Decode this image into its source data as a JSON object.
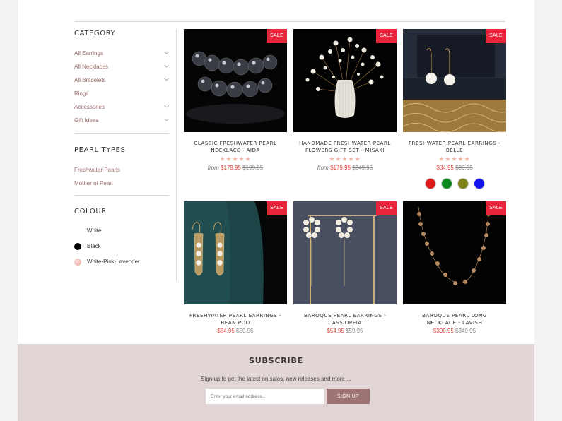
{
  "sidebar": {
    "category_heading": "CATEGORY",
    "categories": [
      {
        "label": "All Earrings",
        "expandable": true
      },
      {
        "label": "All Necklaces",
        "expandable": true
      },
      {
        "label": "All Bracelets",
        "expandable": true
      },
      {
        "label": "Rings",
        "expandable": false
      },
      {
        "label": "Accessories",
        "expandable": true
      },
      {
        "label": "Gift Ideas",
        "expandable": true
      }
    ],
    "pearl_types_heading": "PEARL TYPES",
    "pearl_types": [
      "Freshwater Pearls",
      "Mother of Pearl"
    ],
    "colour_heading": "COLOUR",
    "colours": [
      {
        "label": "White",
        "swatch": "#ffffff"
      },
      {
        "label": "Black",
        "swatch": "#000000"
      },
      {
        "label": "White-Pink-Lavender",
        "swatch": "#f2b6b0"
      }
    ]
  },
  "products": [
    {
      "name": "CLASSIC FRESHWATER PEARL NECKLACE - AIDA",
      "badge": "SALE",
      "rating": 5,
      "stars": "★★★★★",
      "from": "from",
      "price": "$179.95",
      "old_price": "$199.95"
    },
    {
      "name": "HANDMADE FRESHWATER PEARL FLOWERS GIFT SET - MISAKI",
      "badge": "SALE",
      "rating": 5,
      "stars": "★★★★★",
      "from": "from",
      "price": "$179.95",
      "old_price": "$249.95"
    },
    {
      "name": "FRESHWATER PEARL EARRINGS - BELLE",
      "badge": "SALE",
      "rating": 5,
      "stars": "★★★★★",
      "price": "$34.95",
      "old_price": "$39.95",
      "color_options": [
        "#e01b1b",
        "#0b8a1c",
        "#7f8418",
        "#1414f0"
      ]
    },
    {
      "name": "FRESHWATER PEARL EARRINGS - BEAN POD",
      "badge": "SALE",
      "price": "$54.95",
      "old_price": "$59.95"
    },
    {
      "name": "BAROQUE PEARL EARRINGS - CASSIOPEIA",
      "badge": "SALE",
      "price": "$54.95",
      "old_price": "$59.95"
    },
    {
      "name": "BAROQUE PEARL LONG NECKLACE - LAVISH",
      "badge": "SALE",
      "price": "$309.95",
      "old_price": "$349.95"
    }
  ],
  "subscribe": {
    "title": "SUBSCRIBE",
    "text": "Sign up to get the latest on sales, new releases and more ...",
    "placeholder": "Enter your email address...",
    "button": "SIGN UP"
  },
  "colors": {
    "sale_badge": "#e8253b",
    "price": "#e2463e",
    "accent": "#9e7474",
    "subscribe_bg": "#e1d5d5",
    "sidebar_link": "#9a6b6b"
  }
}
